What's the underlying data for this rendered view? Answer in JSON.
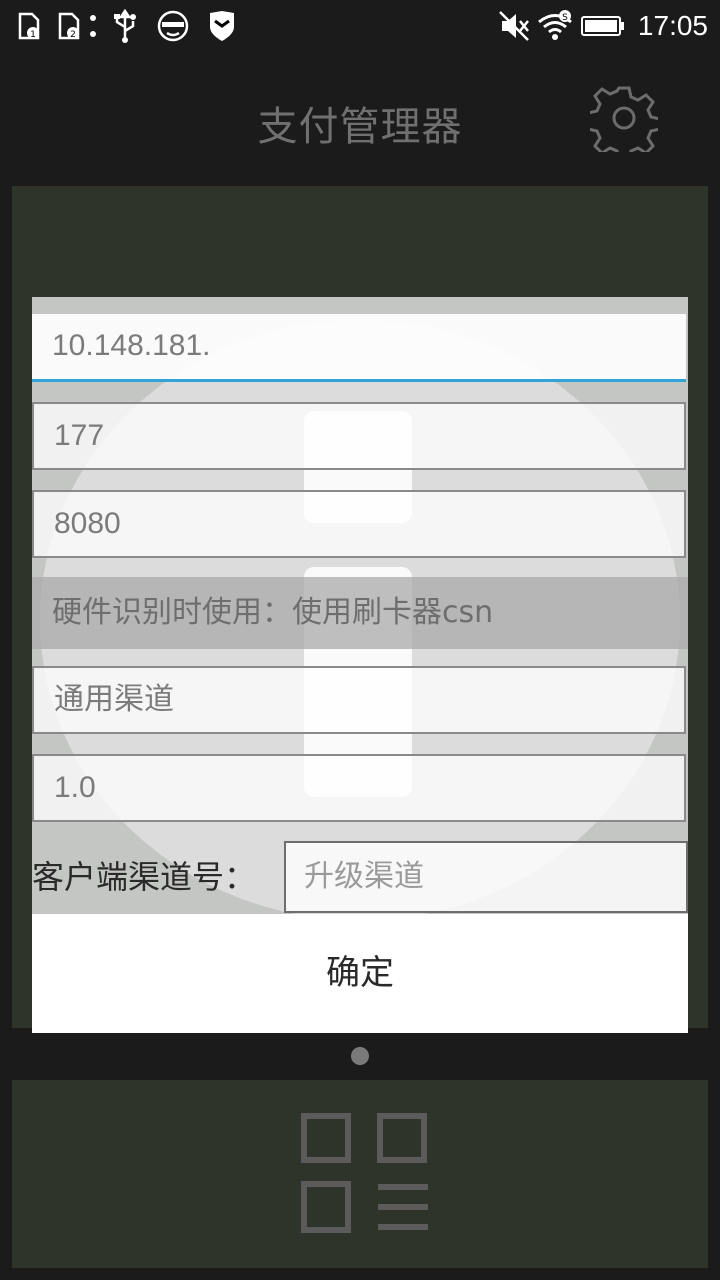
{
  "status_bar": {
    "time": "17:05",
    "icons": [
      "sim1-icon",
      "sim2-icon",
      "more-dots-icon",
      "usb-icon",
      "face-mask-icon",
      "shield-icon",
      "mute-icon",
      "wifi-icon",
      "battery-icon"
    ]
  },
  "header": {
    "title": "支付管理器",
    "settings_icon": "gear-icon"
  },
  "dialog": {
    "fields": {
      "ip": "10.148.181.",
      "ip_suffix": "177",
      "port": "8080",
      "hardware": "硬件识别时使用：使用刷卡器csn",
      "channel": "通用渠道",
      "version": "1.0"
    },
    "client_channel": {
      "label": "客户端渠道号：",
      "placeholder": "升级渠道"
    },
    "confirm_label": "确定"
  },
  "bottom": {
    "apps_icon": "grid-apps-icon"
  }
}
